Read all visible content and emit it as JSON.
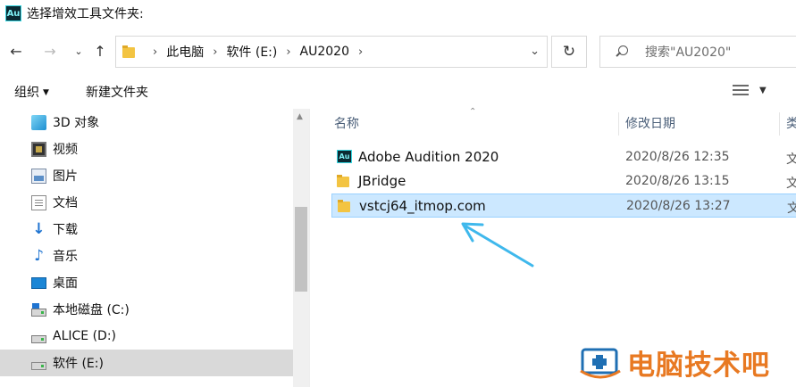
{
  "window": {
    "title": "选择增效工具文件夹:",
    "app_icon_text": "Au"
  },
  "nav": {
    "breadcrumbs": [
      "此电脑",
      "软件 (E:)",
      "AU2020"
    ],
    "search_placeholder": "搜索\"AU2020\""
  },
  "toolbar": {
    "organize_label": "组织",
    "new_folder_label": "新建文件夹"
  },
  "sidebar": {
    "items": [
      {
        "label": "3D 对象",
        "icon": "3d-objects-icon"
      },
      {
        "label": "视频",
        "icon": "videos-icon"
      },
      {
        "label": "图片",
        "icon": "pictures-icon"
      },
      {
        "label": "文档",
        "icon": "documents-icon"
      },
      {
        "label": "下载",
        "icon": "downloads-icon"
      },
      {
        "label": "音乐",
        "icon": "music-icon"
      },
      {
        "label": "桌面",
        "icon": "desktop-icon"
      },
      {
        "label": "本地磁盘 (C:)",
        "icon": "drive-c-icon"
      },
      {
        "label": "ALICE (D:)",
        "icon": "drive-d-icon"
      },
      {
        "label": "软件 (E:)",
        "icon": "drive-e-icon",
        "selected": true
      }
    ]
  },
  "columns": {
    "name": "名称",
    "date": "修改日期",
    "type": "类"
  },
  "files": [
    {
      "name": "Adobe Audition 2020",
      "date": "2020/8/26 12:35",
      "type": "文",
      "icon": "audition-app-icon"
    },
    {
      "name": "JBridge",
      "date": "2020/8/26 13:15",
      "type": "文",
      "icon": "folder-icon"
    },
    {
      "name": "vstcj64_itmop.com",
      "date": "2020/8/26 13:27",
      "type": "文",
      "icon": "folder-icon",
      "selected": true
    }
  ],
  "watermark": {
    "text": "电脑技术吧"
  },
  "colors": {
    "selection": "#cce8ff",
    "arrow": "#3fb8ec",
    "watermark": "#e87922"
  }
}
